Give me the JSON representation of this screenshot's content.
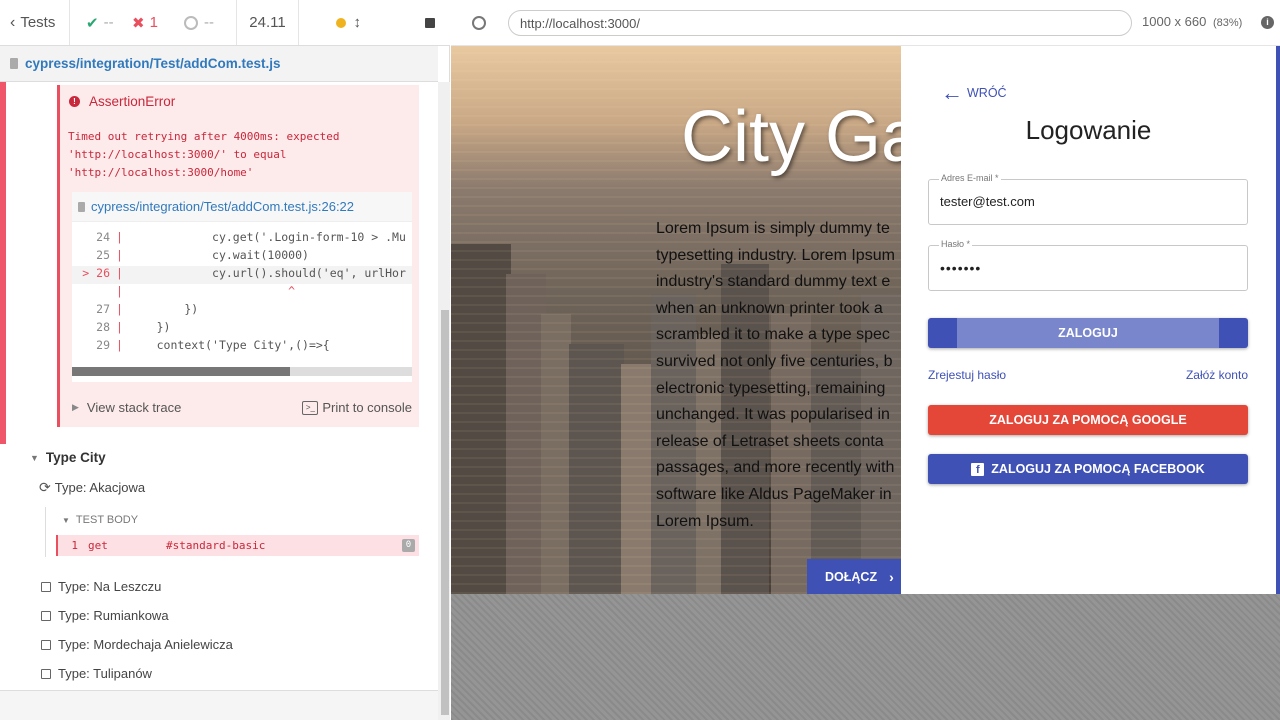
{
  "topbar": {
    "tests_label": "Tests",
    "passed": "--",
    "failed": "1",
    "pending": "--",
    "duration": "24.11"
  },
  "url_bar": {
    "url": "http://localhost:3000/",
    "viewport": "1000 x 660",
    "scale": "(83%)"
  },
  "spec_file": "cypress/integration/Test/addCom.test.js",
  "error": {
    "title": "AssertionError",
    "message_lines": [
      "Timed out retrying after 4000ms: expected",
      "'http://localhost:3000/' to equal",
      "'http://localhost:3000/home'"
    ],
    "file_link": "cypress/integration/Test/addCom.test.js:26:22",
    "code": [
      {
        "num": "24",
        "text": "            cy.get('.Login-form-10 > .Mu"
      },
      {
        "num": "25",
        "text": "            cy.wait(10000)"
      },
      {
        "num": "> 26",
        "text": "            cy.url().should('eq', urlHor"
      },
      {
        "num": "",
        "text": "                       ^"
      },
      {
        "num": "27",
        "text": "        })"
      },
      {
        "num": "28",
        "text": "    })"
      },
      {
        "num": "29",
        "text": "    context('Type City',()=>{"
      }
    ],
    "view_stack": "View stack trace",
    "print_console": "Print to console"
  },
  "suite": {
    "title": "Type City",
    "running_test": "Type: Akacjowa",
    "test_body_label": "TEST BODY",
    "command": {
      "num": "1",
      "name": "get",
      "selector": "#standard-basic",
      "badge": "0"
    },
    "tests": [
      "Type: Na Leszczu",
      "Type: Rumiankowa",
      "Type: Mordechaja Anielewicza",
      "Type: Tulipanów"
    ]
  },
  "app": {
    "hero_title": "City Ga",
    "lorem_lines": [
      "Lorem Ipsum is simply dummy te",
      "typesetting industry. Lorem Ipsum",
      "industry's standard dummy text e",
      "when an unknown printer took a",
      "scrambled it to make a type spec",
      "survived not only five centuries, b",
      "electronic typesetting, remaining",
      "unchanged. It was popularised in",
      "release of Letraset sheets conta",
      "passages, and more recently with",
      "software like Aldus PageMaker in",
      "Lorem Ipsum."
    ],
    "join_button": "DOŁĄCZ",
    "login": {
      "back": "WRÓĆ",
      "title": "Logowanie",
      "email_label": "Adres E-mail *",
      "email_value": "tester@test.com",
      "password_label": "Hasło *",
      "password_value": "•••••••",
      "submit": "ZALOGUJ",
      "forgot": "Zrejestuj hasło",
      "register": "Załóż konto",
      "google": "ZALOGUJ ZA POMOCĄ GOOGLE",
      "facebook": "ZALOGUJ ZA POMOCĄ FACEBOOK"
    }
  },
  "colors": {
    "accent_blue": "#3f51b5",
    "light_blue": "#7986cb",
    "google_red": "#e44638",
    "error_red": "#e94f5f",
    "pass_green": "#2aa772"
  }
}
